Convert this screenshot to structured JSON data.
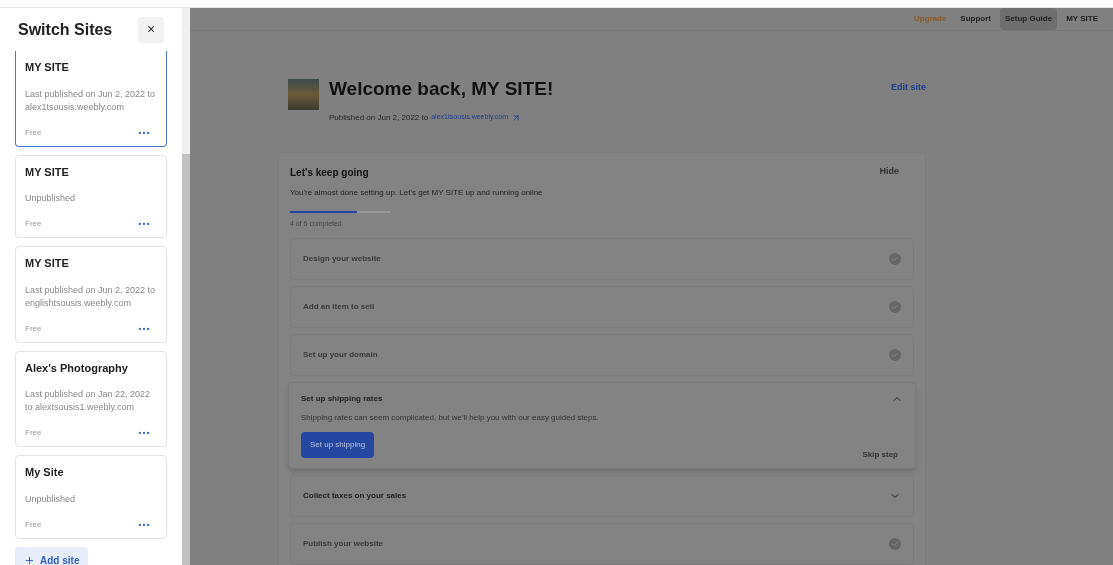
{
  "sidebar": {
    "title": "Switch Sites",
    "close": "×",
    "sites": [
      {
        "name": "MY SITE",
        "status": "Last published on Jun 2, 2022 to alex1tsousis.weebly.com",
        "plan": "Free",
        "selected": true
      },
      {
        "name": "MY SITE",
        "status": "Unpublished",
        "plan": "Free",
        "selected": false
      },
      {
        "name": "MY SITE",
        "status": "Last published on Jun 2, 2022 to englishtsousis.weebly.com",
        "plan": "Free",
        "selected": false
      },
      {
        "name": "Alex's Photography",
        "status": "Last published on Jan 22, 2022 to alextsousis1.weebly.com",
        "plan": "Free",
        "selected": false
      },
      {
        "name": "My Site",
        "status": "Unpublished",
        "plan": "Free",
        "selected": false
      }
    ],
    "add_site": "Add site"
  },
  "top_nav": [
    {
      "label": "Upgrade",
      "kind": "upgrade",
      "selected": false
    },
    {
      "label": "Support",
      "kind": "link",
      "selected": false
    },
    {
      "label": "Setup Guide",
      "kind": "link",
      "selected": true
    },
    {
      "label": "MY SITE",
      "kind": "link",
      "selected": false
    }
  ],
  "header": {
    "title": "Welcome back, MY SITE!",
    "published": "Published on Jun 2, 2022 to",
    "url": "alex1tsousis.weebly.com",
    "edit": "Edit site"
  },
  "setup": {
    "title": "Let's keep going",
    "hide": "Hide",
    "subtitle": "You're almost done setting up. Let's get MY SITE up and running online",
    "progress": {
      "level": 0.67,
      "label": "4 of 6 completed"
    },
    "steps": [
      {
        "title": "Design your website",
        "completed": true,
        "expanded": false
      },
      {
        "title": "Add an item to sell",
        "completed": true,
        "expanded": false
      },
      {
        "title": "Set up your domain",
        "completed": true,
        "expanded": false
      },
      {
        "title": "Set up shipping rates",
        "completed": false,
        "expanded": true,
        "description": "Shipping rates can seem complicated, but we'll help you with our easy guided steps.",
        "action": "Set up shipping",
        "skip": "Skip step"
      },
      {
        "title": "Collect taxes on your sales",
        "completed": false,
        "expanded": false
      },
      {
        "title": "Publish your website",
        "completed": true,
        "expanded": false
      }
    ]
  }
}
